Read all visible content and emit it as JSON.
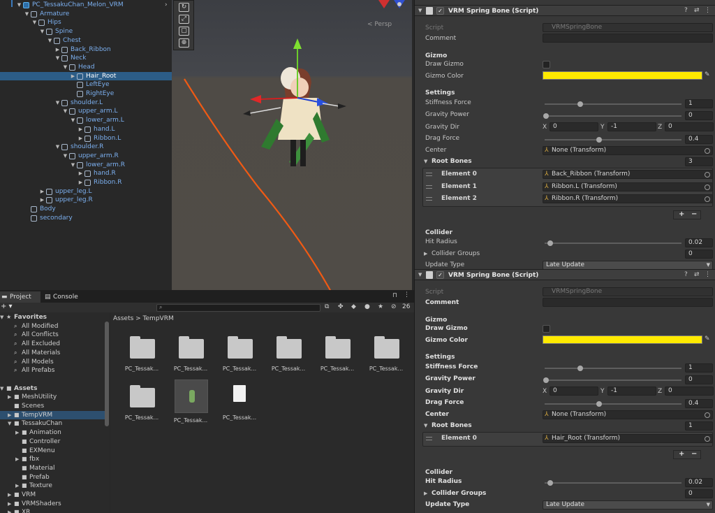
{
  "hierarchy": {
    "items": [
      {
        "label": "PC_TessakuChan_Melon_VRM",
        "depth": 0,
        "expanded": true,
        "root": true
      },
      {
        "label": "Armature",
        "depth": 1,
        "expanded": true
      },
      {
        "label": "Hips",
        "depth": 2,
        "expanded": true
      },
      {
        "label": "Spine",
        "depth": 3,
        "expanded": true
      },
      {
        "label": "Chest",
        "depth": 4,
        "expanded": true
      },
      {
        "label": "Back_Ribbon",
        "depth": 5,
        "expanded": false
      },
      {
        "label": "Neck",
        "depth": 5,
        "expanded": true
      },
      {
        "label": "Head",
        "depth": 6,
        "expanded": true
      },
      {
        "label": "Hair_Root",
        "depth": 7,
        "expanded": false,
        "selected": true
      },
      {
        "label": "LeftEye",
        "depth": 7,
        "leaf": true
      },
      {
        "label": "RightEye",
        "depth": 7,
        "leaf": true
      },
      {
        "label": "shoulder.L",
        "depth": 5,
        "expanded": true
      },
      {
        "label": "upper_arm.L",
        "depth": 6,
        "expanded": true
      },
      {
        "label": "lower_arm.L",
        "depth": 7,
        "expanded": true
      },
      {
        "label": "hand.L",
        "depth": 8,
        "expanded": false
      },
      {
        "label": "Ribbon.L",
        "depth": 8,
        "expanded": false
      },
      {
        "label": "shoulder.R",
        "depth": 5,
        "expanded": true
      },
      {
        "label": "upper_arm.R",
        "depth": 6,
        "expanded": true
      },
      {
        "label": "lower_arm.R",
        "depth": 7,
        "expanded": true
      },
      {
        "label": "hand.R",
        "depth": 8,
        "expanded": false
      },
      {
        "label": "Ribbon.R",
        "depth": 8,
        "expanded": false
      },
      {
        "label": "upper_leg.L",
        "depth": 3,
        "expanded": false
      },
      {
        "label": "upper_leg.R",
        "depth": 3,
        "expanded": false
      },
      {
        "label": "Body",
        "depth": 1,
        "leaf": true
      },
      {
        "label": "secondary",
        "depth": 1,
        "leaf": true
      }
    ]
  },
  "scene": {
    "persp_label": "< Persp",
    "tools": [
      "↻",
      "⤢",
      "▢",
      "⊕"
    ]
  },
  "project": {
    "tab_project": "Project",
    "tab_console": "Console",
    "add_label": "+ ▾",
    "hidden_count": "26",
    "breadcrumb": "Assets  >  TempVRM",
    "tree": [
      {
        "label": "Favorites",
        "depth": 0,
        "arrow": "▼",
        "icon": "★",
        "bold": true
      },
      {
        "label": "All Modified",
        "depth": 1,
        "icon": "🔍"
      },
      {
        "label": "All Conflicts",
        "depth": 1,
        "icon": "🔍"
      },
      {
        "label": "All Excluded",
        "depth": 1,
        "icon": "🔍"
      },
      {
        "label": "All Materials",
        "depth": 1,
        "icon": "🔍"
      },
      {
        "label": "All Models",
        "depth": 1,
        "icon": "🔍"
      },
      {
        "label": "All Prefabs",
        "depth": 1,
        "icon": "🔍"
      },
      {
        "label": "",
        "depth": 0
      },
      {
        "label": "Assets",
        "depth": 0,
        "arrow": "▼",
        "icon": "📂",
        "bold": true
      },
      {
        "label": "MeshUtility",
        "depth": 1,
        "arrow": "▶",
        "icon": "📁"
      },
      {
        "label": "Scenes",
        "depth": 1,
        "icon": "📁"
      },
      {
        "label": "TempVRM",
        "depth": 1,
        "arrow": "▶",
        "icon": "📁",
        "selected": true
      },
      {
        "label": "TessakuChan",
        "depth": 1,
        "arrow": "▼",
        "icon": "📂"
      },
      {
        "label": "Animation",
        "depth": 2,
        "arrow": "▶",
        "icon": "📁"
      },
      {
        "label": "Controller",
        "depth": 2,
        "icon": "📁"
      },
      {
        "label": "EXMenu",
        "depth": 2,
        "icon": "📁"
      },
      {
        "label": "fbx",
        "depth": 2,
        "arrow": "▶",
        "icon": "📁"
      },
      {
        "label": "Material",
        "depth": 2,
        "icon": "📁"
      },
      {
        "label": "Prefab",
        "depth": 2,
        "icon": "📁"
      },
      {
        "label": "Texture",
        "depth": 2,
        "arrow": "▶",
        "icon": "📁"
      },
      {
        "label": "VRM",
        "depth": 1,
        "arrow": "▶",
        "icon": "📁"
      },
      {
        "label": "VRMShaders",
        "depth": 1,
        "arrow": "▶",
        "icon": "📁"
      },
      {
        "label": "XR",
        "depth": 1,
        "arrow": "▶",
        "icon": "📁"
      }
    ],
    "files": [
      {
        "label": "PC_Tessak...",
        "kind": "folder"
      },
      {
        "label": "PC_Tessak...",
        "kind": "folder"
      },
      {
        "label": "PC_Tessak...",
        "kind": "folder"
      },
      {
        "label": "PC_Tessak...",
        "kind": "folder"
      },
      {
        "label": "PC_Tessak...",
        "kind": "folder"
      },
      {
        "label": "PC_Tessak...",
        "kind": "folder"
      },
      {
        "label": "PC_Tessak...",
        "kind": "folder"
      },
      {
        "label": "PC_Tessak...",
        "kind": "model"
      },
      {
        "label": "PC_Tessak...",
        "kind": "file"
      }
    ]
  },
  "inspector": {
    "components": [
      {
        "title": "VRM Spring Bone (Script)",
        "script_label": "Script",
        "script_value": "VRMSpringBone",
        "comment_label": "Comment",
        "gizmo_section": "Gizmo",
        "draw_gizmo_label": "Draw Gizmo",
        "gizmo_color_label": "Gizmo Color",
        "settings_section": "Settings",
        "stiffness_label": "Stiffness Force",
        "stiffness_value": "1",
        "stiffness_fraction": 0.25,
        "gravity_power_label": "Gravity Power",
        "gravity_power_value": "0",
        "gravity_power_fraction": 0.0,
        "gravity_dir_label": "Gravity Dir",
        "gravity_dir_x": "0",
        "gravity_dir_y": "-1",
        "gravity_dir_z": "0",
        "drag_label": "Drag Force",
        "drag_value": "0.4",
        "drag_fraction": 0.4,
        "center_label": "Center",
        "center_value": "None (Transform)",
        "root_bones_label": "Root Bones",
        "root_bones_count": "3",
        "elements": [
          {
            "label": "Element 0",
            "value": "Back_Ribbon (Transform)"
          },
          {
            "label": "Element 1",
            "value": "Ribbon.L (Transform)"
          },
          {
            "label": "Element 2",
            "value": "Ribbon.R (Transform)"
          }
        ],
        "collider_section": "Collider",
        "hit_radius_label": "Hit Radius",
        "hit_radius_value": "0.02",
        "hit_radius_fraction": 0.02,
        "collider_groups_label": "Collider Groups",
        "collider_groups_count": "0",
        "update_type_label": "Update Type",
        "update_type_value": "Late Update",
        "overridden": false
      },
      {
        "title": "VRM Spring Bone (Script)",
        "script_label": "Script",
        "script_value": "VRMSpringBone",
        "comment_label": "Comment",
        "gizmo_section": "Gizmo",
        "draw_gizmo_label": "Draw Gizmo",
        "gizmo_color_label": "Gizmo Color",
        "settings_section": "Settings",
        "stiffness_label": "Stiffness Force",
        "stiffness_value": "1",
        "stiffness_fraction": 0.25,
        "gravity_power_label": "Gravity Power",
        "gravity_power_value": "0",
        "gravity_power_fraction": 0.0,
        "gravity_dir_label": "Gravity Dir",
        "gravity_dir_x": "0",
        "gravity_dir_y": "-1",
        "gravity_dir_z": "0",
        "drag_label": "Drag Force",
        "drag_value": "0.4",
        "drag_fraction": 0.4,
        "center_label": "Center",
        "center_value": "None (Transform)",
        "root_bones_label": "Root Bones",
        "root_bones_count": "1",
        "elements": [
          {
            "label": "Element 0",
            "value": "Hair_Root (Transform)"
          }
        ],
        "collider_section": "Collider",
        "hit_radius_label": "Hit Radius",
        "hit_radius_value": "0.02",
        "hit_radius_fraction": 0.02,
        "collider_groups_label": "Collider Groups",
        "collider_groups_count": "0",
        "update_type_label": "Update Type",
        "update_type_value": "Late Update",
        "overridden": true
      }
    ]
  },
  "colors": {
    "gizmo": "#ffea00",
    "selection": "#2c5d87",
    "annotation_arrow": "#f05a14",
    "hierarchy_text": "#7cb0f0"
  }
}
